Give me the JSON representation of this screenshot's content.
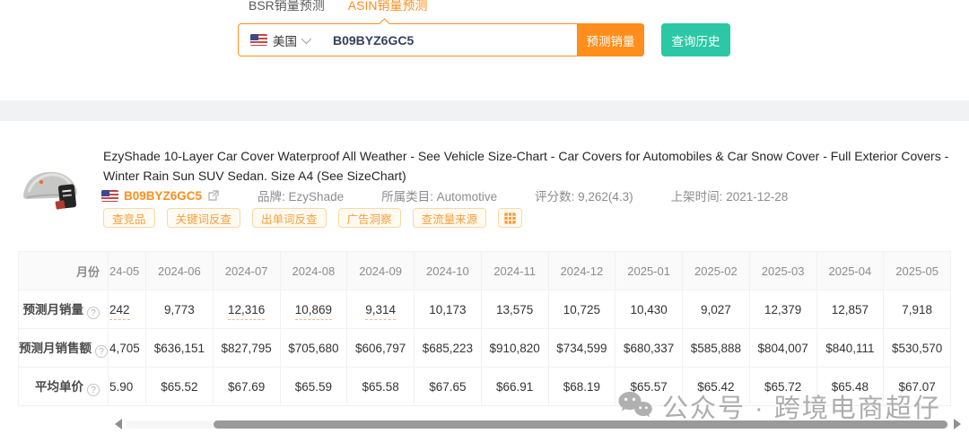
{
  "colors": {
    "accent_orange": "#ff8e1c",
    "teal": "#2cc8a5",
    "table_value_orange": "#f68e55"
  },
  "tabs": [
    {
      "label": "BSR销量预测",
      "active": false
    },
    {
      "label": "ASIN销量预测",
      "active": true
    }
  ],
  "search": {
    "country": "美国",
    "asin": "B09BYZ6GC5",
    "predict_button": "预测销量",
    "history_button": "查询历史"
  },
  "product": {
    "title": "EzyShade 10-Layer Car Cover Waterproof All Weather - See Vehicle Size-Chart - Car Covers for Automobiles & Car Snow Cover - Full Exterior Covers - Winter Rain Sun SUV Sedan. Size A4 (See SizeChart)",
    "asin": "B09BYZ6GC5",
    "brand": "品牌: EzyShade",
    "category": "所属类目: Automotive",
    "rating": "评分数: 9,262(4.3)",
    "listed_date": "上架时间: 2021-12-28",
    "tags": [
      "查竞品",
      "关键词反查",
      "出单词反查",
      "广告洞察",
      "查流量来源"
    ]
  },
  "table": {
    "row_headers": [
      "月份",
      "预测月销量",
      "预测月销售额",
      "平均单价"
    ],
    "months": [
      "24-05",
      "2024-06",
      "2024-07",
      "2024-08",
      "2024-09",
      "2024-10",
      "2024-11",
      "2024-12",
      "2025-01",
      "2025-02",
      "2025-03",
      "2025-04",
      "2025-05"
    ],
    "sales_volume": [
      "242",
      "9,773",
      "12,316",
      "10,869",
      "9,314",
      "10,173",
      "13,575",
      "10,725",
      "10,430",
      "9,027",
      "12,379",
      "12,857",
      "7,918"
    ],
    "volume_dashed": [
      true,
      false,
      true,
      true,
      true,
      false,
      false,
      false,
      false,
      false,
      false,
      false,
      false
    ],
    "revenue": [
      "4,705",
      "$636,151",
      "$827,795",
      "$705,680",
      "$606,797",
      "$685,223",
      "$910,820",
      "$734,599",
      "$680,337",
      "$585,888",
      "$804,007",
      "$840,111",
      "$530,570"
    ],
    "avg_price": [
      "5.90",
      "$65.52",
      "$67.69",
      "$65.59",
      "$65.58",
      "$67.65",
      "$66.91",
      "$68.19",
      "$65.57",
      "$65.42",
      "$65.72",
      "$65.48",
      "$67.07"
    ]
  },
  "watermark": "公众号 · 跨境电商超仔"
}
